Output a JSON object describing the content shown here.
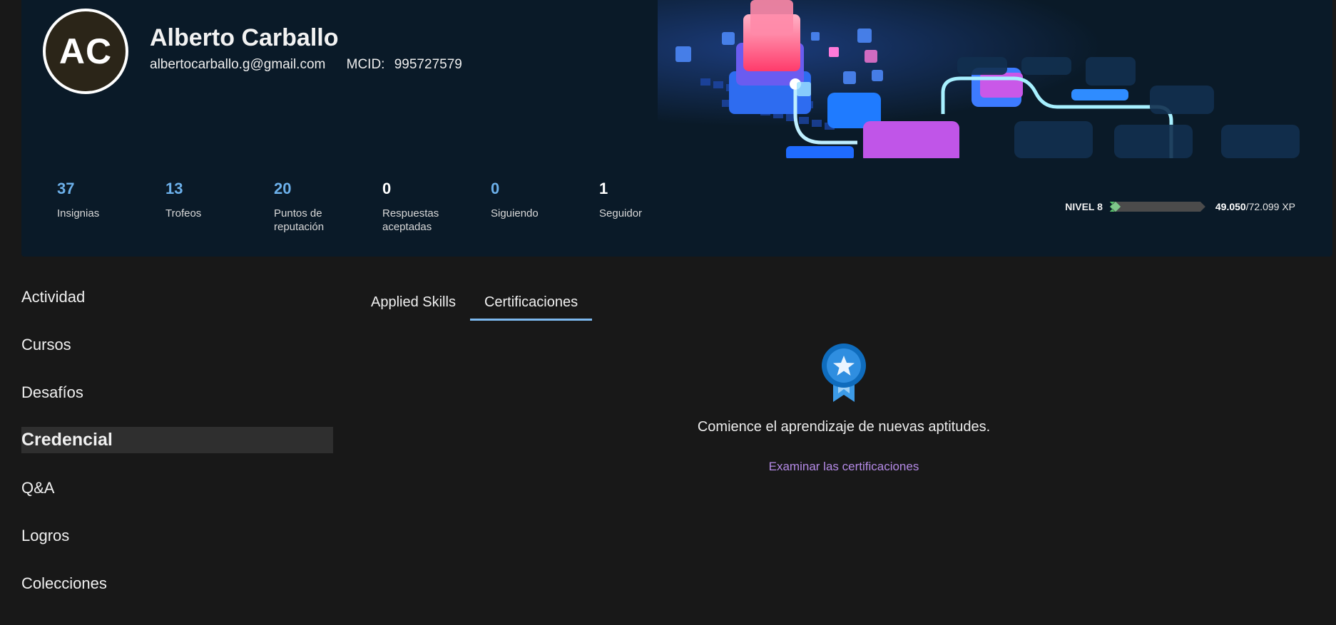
{
  "profile": {
    "initials": "AC",
    "name": "Alberto Carballo",
    "email": "albertocarballo.g@gmail.com",
    "mcid_label": "MCID:",
    "mcid_value": "995727579"
  },
  "stats": [
    {
      "value": "37",
      "label": "Insignias"
    },
    {
      "value": "13",
      "label": "Trofeos"
    },
    {
      "value": "20",
      "label": "Puntos de reputación"
    },
    {
      "value": "0",
      "label": "Respuestas aceptadas"
    },
    {
      "value": "0",
      "label": "Siguiendo"
    },
    {
      "value": "1",
      "label": "Seguidor"
    }
  ],
  "level": {
    "label": "NIVEL 8",
    "xp_current": "49.050",
    "xp_total": "/72.099 XP",
    "progress": 0.05
  },
  "sidebar": {
    "items": [
      {
        "label": "Actividad"
      },
      {
        "label": "Cursos"
      },
      {
        "label": "Desafíos"
      },
      {
        "label": "Credencial"
      },
      {
        "label": "Q&A"
      },
      {
        "label": "Logros"
      },
      {
        "label": "Colecciones"
      }
    ],
    "active_index": 3
  },
  "tabs": [
    {
      "label": "Applied Skills"
    },
    {
      "label": "Certificaciones"
    }
  ],
  "empty_state": {
    "icon": "award-ribbon-icon",
    "message": "Comience el aprendizaje de nuevas aptitudes.",
    "link": "Examinar las certificaciones"
  },
  "colors": {
    "background": "#181818",
    "card": "#0a1a28",
    "accent_blue": "#6cb0ea",
    "tab_underline": "#7cb8ee",
    "link": "#b48ae6",
    "xp_fill": "#58c16a"
  }
}
